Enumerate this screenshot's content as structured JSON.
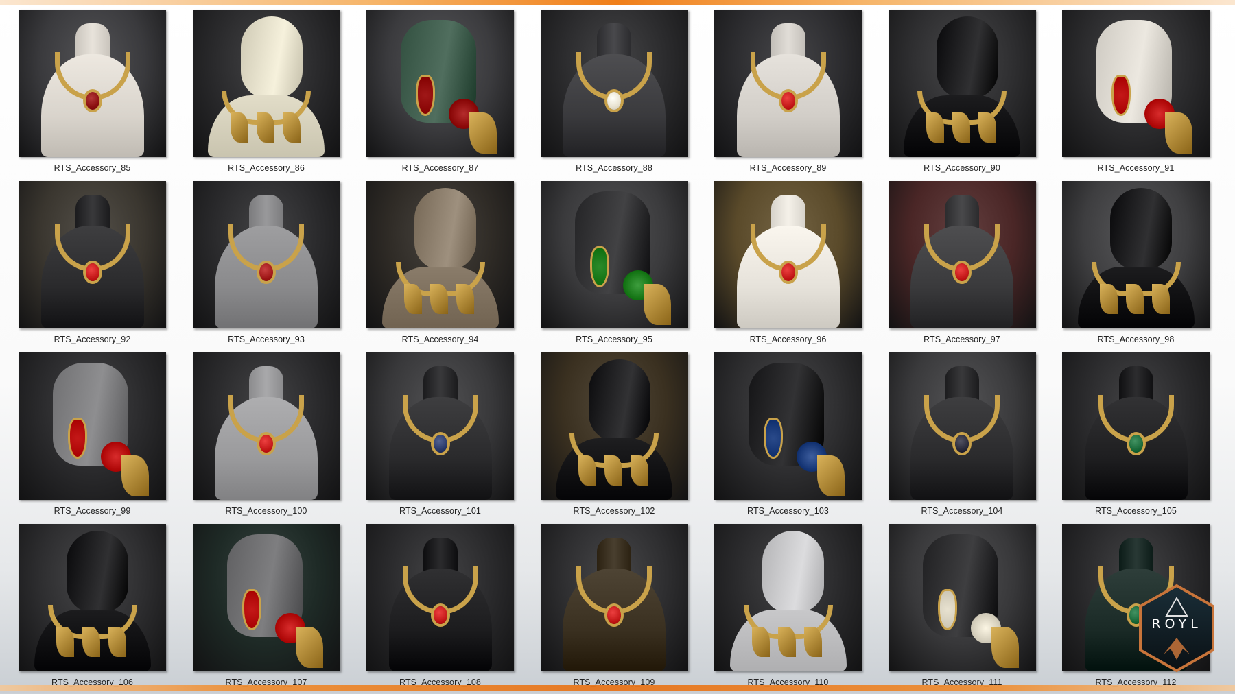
{
  "gallery": {
    "items": [
      {
        "name": "RTS_Accessory_85",
        "bust": "#d9d4cc",
        "bg": "#3a3a3d",
        "metal": "#c9a24a",
        "gem": "#8b1010"
      },
      {
        "name": "RTS_Accessory_86",
        "bust": "#e2ddc8",
        "bg": "#2a2a2c",
        "metal": "#c9a24a",
        "gem": "#cc1515"
      },
      {
        "name": "RTS_Accessory_87",
        "bust": "#3c5a4a",
        "bg": "#3b3b3e",
        "metal": "#c9a24a",
        "gem": "#a01818"
      },
      {
        "name": "RTS_Accessory_88",
        "bust": "#3a3a3d",
        "bg": "#2b2b2d",
        "metal": "#c9a24a",
        "gem": "#e8e2d0"
      },
      {
        "name": "RTS_Accessory_89",
        "bust": "#d2cec8",
        "bg": "#2d2d30",
        "metal": "#c9a24a",
        "gem": "#c41818"
      },
      {
        "name": "RTS_Accessory_90",
        "bust": "#1c1c1e",
        "bg": "#2e2e30",
        "metal": "#c9a24a",
        "gem": "#1a7a2a"
      },
      {
        "name": "RTS_Accessory_91",
        "bust": "#d8d4cc",
        "bg": "#2c2c2e",
        "metal": "#c9a24a",
        "gem": "#c41818"
      },
      {
        "name": "RTS_Accessory_92",
        "bust": "#2a2a2c",
        "bg": "#3a362f",
        "metal": "#c9a24a",
        "gem": "#c41818"
      },
      {
        "name": "RTS_Accessory_93",
        "bust": "#8a8a8c",
        "bg": "#2a2a2c",
        "metal": "#c9a24a",
        "gem": "#a01818"
      },
      {
        "name": "RTS_Accessory_94",
        "bust": "#8a7c6a",
        "bg": "#2f2b26",
        "metal": "#c9a24a",
        "gem": "#1a6a3a"
      },
      {
        "name": "RTS_Accessory_95",
        "bust": "#2e2e30",
        "bg": "#3a3a3c",
        "metal": "#c9a24a",
        "gem": "#2a8a2a"
      },
      {
        "name": "RTS_Accessory_96",
        "bust": "#e6e2da",
        "bg": "#5a4a2a",
        "metal": "#c9a24a",
        "gem": "#c41818"
      },
      {
        "name": "RTS_Accessory_97",
        "bust": "#3a3a3c",
        "bg": "#4a2626",
        "metal": "#c9a24a",
        "gem": "#c41818"
      },
      {
        "name": "RTS_Accessory_98",
        "bust": "#1c1c1e",
        "bg": "#3e3e40",
        "metal": "#c9a24a",
        "gem": "#c41818"
      },
      {
        "name": "RTS_Accessory_99",
        "bust": "#7a7a7c",
        "bg": "#2a2a2c",
        "metal": "#c9a24a",
        "gem": "#c41818"
      },
      {
        "name": "RTS_Accessory_100",
        "bust": "#9a9a9c",
        "bg": "#2a2a2c",
        "metal": "#c9a24a",
        "gem": "#c41818"
      },
      {
        "name": "RTS_Accessory_101",
        "bust": "#2a2a2c",
        "bg": "#38383a",
        "metal": "#c9a24a",
        "gem": "#2a3a6a"
      },
      {
        "name": "RTS_Accessory_102",
        "bust": "#1e1e20",
        "bg": "#3a3020",
        "metal": "#c9a24a",
        "gem": "#4a6a8a"
      },
      {
        "name": "RTS_Accessory_103",
        "bust": "#1e1e20",
        "bg": "#2e2e30",
        "metal": "#c9a24a",
        "gem": "#2a4a8a"
      },
      {
        "name": "RTS_Accessory_104",
        "bust": "#2a2a2c",
        "bg": "#3a3a3c",
        "metal": "#c9a24a",
        "gem": "#2a2a3a"
      },
      {
        "name": "RTS_Accessory_105",
        "bust": "#1e1e20",
        "bg": "#2a2a2c",
        "metal": "#c9a24a",
        "gem": "#1a6a3a"
      },
      {
        "name": "RTS_Accessory_106",
        "bust": "#1c1c1e",
        "bg": "#2e2e30",
        "metal": "#c9a24a",
        "gem": "#c41818"
      },
      {
        "name": "RTS_Accessory_107",
        "bust": "#6a6a6c",
        "bg": "#1e2a26",
        "metal": "#c9a24a",
        "gem": "#c41818"
      },
      {
        "name": "RTS_Accessory_108",
        "bust": "#1c1c1e",
        "bg": "#2a2a2c",
        "metal": "#c9a24a",
        "gem": "#c41818"
      },
      {
        "name": "RTS_Accessory_109",
        "bust": "#3a3020",
        "bg": "#2e2e30",
        "metal": "#c9a24a",
        "gem": "#c41818"
      },
      {
        "name": "RTS_Accessory_110",
        "bust": "#c8c8ca",
        "bg": "#2a2a2c",
        "metal": "#c9a24a",
        "gem": "#c41818"
      },
      {
        "name": "RTS_Accessory_111",
        "bust": "#2a2a2c",
        "bg": "#38383a",
        "metal": "#c9a24a",
        "gem": "#e8e2d0"
      },
      {
        "name": "RTS_Accessory_112",
        "bust": "#1a2a26",
        "bg": "#2a2a2c",
        "metal": "#c9a24a",
        "gem": "#1a6a3a"
      }
    ]
  },
  "logo": {
    "text": "ROYL",
    "colors": {
      "frame": "#c8743a",
      "fill": "#0e1a22",
      "text": "#ffffff"
    }
  },
  "accent_colors": {
    "orange": "#ee7a1a"
  }
}
